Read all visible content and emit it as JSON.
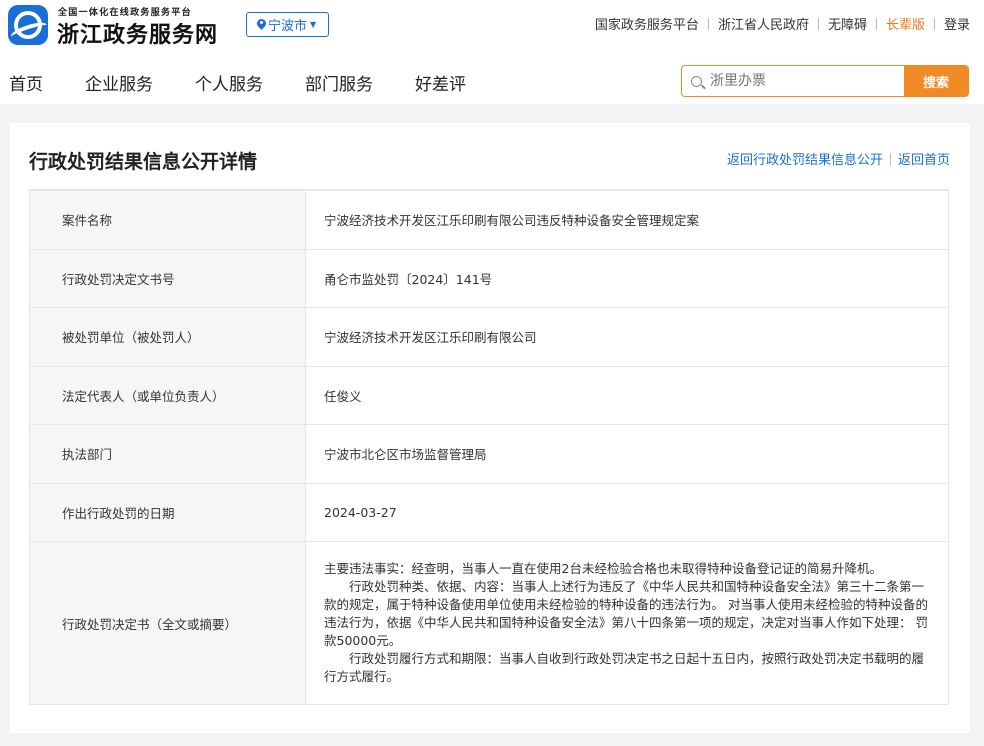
{
  "header": {
    "slogan": "全国一体化在线政务服务平台",
    "site_name": "浙江政务服务网",
    "city": "宁波市",
    "top_links": [
      "国家政务服务平台",
      "浙江省人民政府",
      "无障碍",
      "长辈版",
      "登录"
    ],
    "nav": [
      "首页",
      "企业服务",
      "个人服务",
      "部门服务",
      "好差评"
    ],
    "search": {
      "placeholder": "浙里办票",
      "button": "搜索"
    },
    "colors": {
      "brand_blue": "#1a6fd6",
      "accent_orange": "#f08a24"
    }
  },
  "page": {
    "title": "行政处罚结果信息公开详情",
    "links": [
      "返回行政处罚结果信息公开",
      "返回首页"
    ]
  },
  "details": [
    {
      "label": "案件名称",
      "value": "宁波经济技术开发区江乐印刷有限公司违反特种设备安全管理规定案"
    },
    {
      "label": "行政处罚决定文书号",
      "value": "甬仑市监处罚〔2024〕141号"
    },
    {
      "label": "被处罚单位（被处罚人）",
      "value": "宁波经济技术开发区江乐印刷有限公司"
    },
    {
      "label": "法定代表人（或单位负责人）",
      "value": "任俊义"
    },
    {
      "label": "执法部门",
      "value": "宁波市北仑区市场监督管理局"
    },
    {
      "label": "作出行政处罚的日期",
      "value": "2024-03-27"
    }
  ],
  "decision": {
    "label": "行政处罚决定书（全文或摘要）",
    "p1": "主要违法事实：经查明，当事人一直在使用2台未经检验合格也未取得特种设备登记证的简易升降机。",
    "p2": "行政处罚种类、依据、内容：当事人上述行为违反了《中华人民共和国特种设备安全法》第三十二条第一款的规定，属于特种设备使用单位使用未经检验的特种设备的违法行为。    对当事人使用未经检验的特种设备的违法行为，依据《中华人民共和国特种设备安全法》第八十四条第一项的规定，决定对当事人作如下处理： 罚款50000元。",
    "p3": "行政处罚履行方式和期限：当事人自收到行政处罚决定书之日起十五日内，按照行政处罚决定书载明的履行方式履行。"
  }
}
